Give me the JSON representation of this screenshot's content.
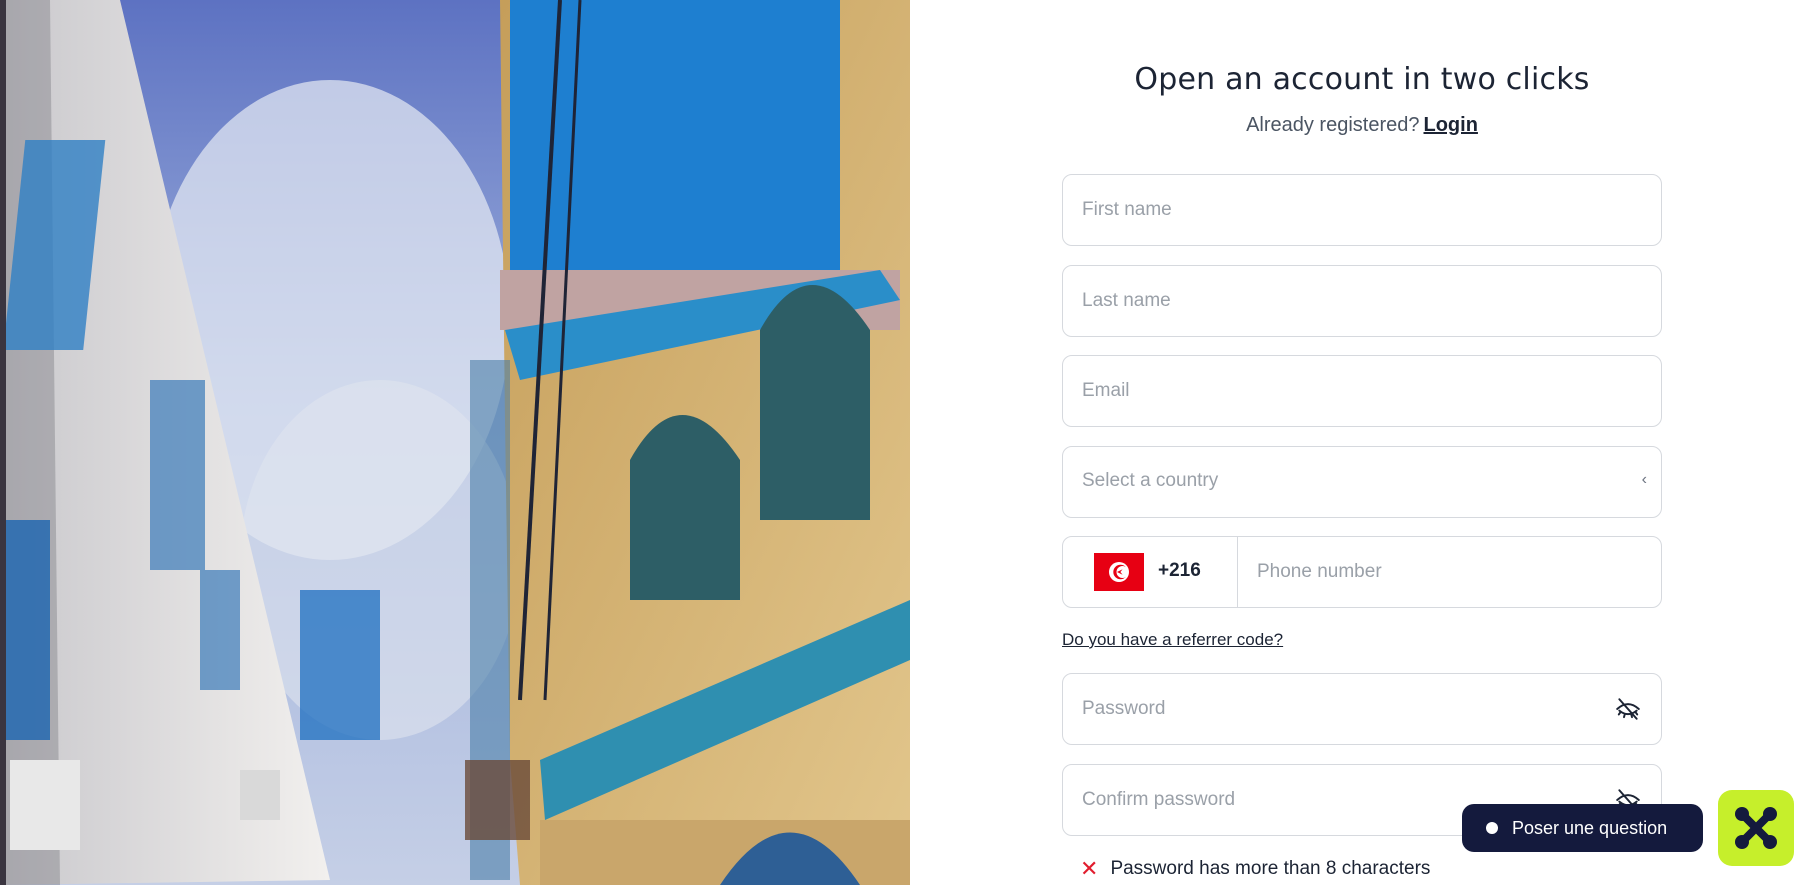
{
  "form": {
    "title": "Open an account in two clicks",
    "already_registered": "Already registered?",
    "login_link": "Login",
    "first_name_placeholder": "First name",
    "last_name_placeholder": "Last name",
    "email_placeholder": "Email",
    "country_placeholder": "Select a country",
    "country_chevron": "‹",
    "phone_dial_code": "+216",
    "phone_flag_icon": "tunisia-flag-icon",
    "phone_placeholder": "Phone number",
    "referrer_link": "Do you have a referrer code?",
    "password_placeholder": "Password",
    "confirm_password_placeholder": "Confirm password",
    "password_rule": "Password has more than 8 characters",
    "password_rule_status_icon": "x-icon"
  },
  "chat": {
    "ask_label": "Poser une question",
    "launcher_icon": "chat-launcher-icon"
  },
  "colors": {
    "accent_dark": "#141a3d",
    "launcher_green": "#c6ef2b",
    "error_red": "#e11d2e",
    "flag_red": "#e70013"
  }
}
